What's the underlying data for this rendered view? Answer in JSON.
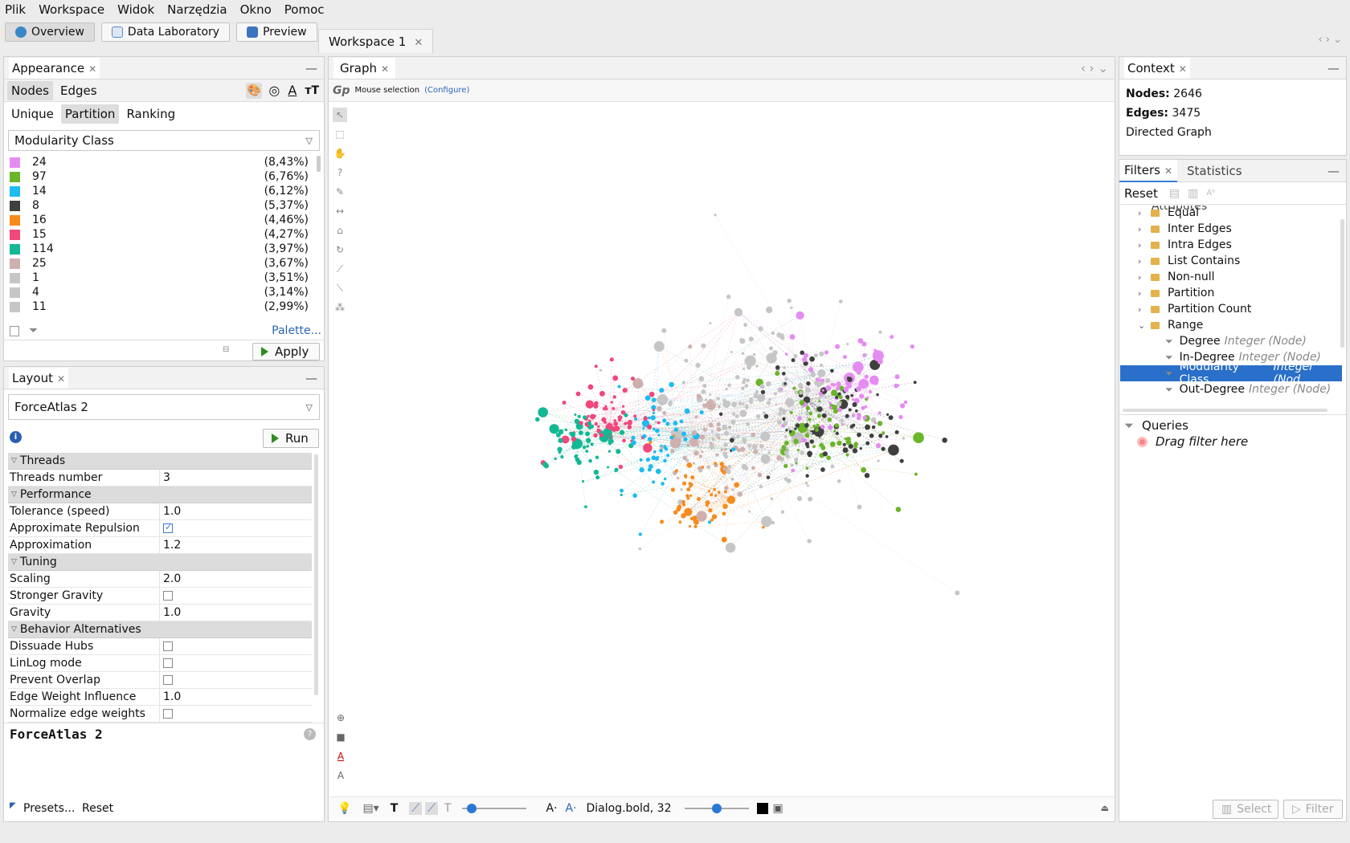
{
  "menu": [
    "Plik",
    "Workspace",
    "Widok",
    "Narzędzia",
    "Okno",
    "Pomoc"
  ],
  "modes": {
    "overview": "Overview",
    "data_lab": "Data Laboratory",
    "preview": "Preview"
  },
  "workspace_tab": "Workspace 1",
  "appearance": {
    "title": "Appearance",
    "tabs": {
      "nodes": "Nodes",
      "edges": "Edges"
    },
    "modes": {
      "unique": "Unique",
      "partition": "Partition",
      "ranking": "Ranking"
    },
    "attribute": "Modularity Class",
    "palette": "Palette...",
    "apply": "Apply",
    "partitions": [
      {
        "label": "24",
        "pct": "(8,43%)",
        "color": "#e58cf2"
      },
      {
        "label": "97",
        "pct": "(6,76%)",
        "color": "#6ab52a"
      },
      {
        "label": "14",
        "pct": "(6,12%)",
        "color": "#1ebbef"
      },
      {
        "label": "8",
        "pct": "(5,37%)",
        "color": "#3f3f3f"
      },
      {
        "label": "16",
        "pct": "(4,46%)",
        "color": "#f78b1c"
      },
      {
        "label": "15",
        "pct": "(4,27%)",
        "color": "#f0477c"
      },
      {
        "label": "114",
        "pct": "(3,97%)",
        "color": "#13b894"
      },
      {
        "label": "25",
        "pct": "(3,67%)",
        "color": "#cfb0ae"
      },
      {
        "label": "1",
        "pct": "(3,51%)",
        "color": "#c6c6c6"
      },
      {
        "label": "4",
        "pct": "(3,14%)",
        "color": "#c6c6c6"
      },
      {
        "label": "11",
        "pct": "(2,99%)",
        "color": "#c6c6c6"
      }
    ]
  },
  "layout": {
    "title": "Layout",
    "algorithm": "ForceAtlas 2",
    "run": "Run",
    "footer_title": "ForceAtlas 2",
    "presets": "Presets...",
    "reset": "Reset",
    "props": [
      {
        "group": "Threads"
      },
      {
        "k": "Threads number",
        "v": "3"
      },
      {
        "group": "Performance"
      },
      {
        "k": "Tolerance (speed)",
        "v": "1.0"
      },
      {
        "k": "Approximate Repulsion",
        "cb": true
      },
      {
        "k": "Approximation",
        "v": "1.2"
      },
      {
        "group": "Tuning"
      },
      {
        "k": "Scaling",
        "v": "2.0"
      },
      {
        "k": "Stronger Gravity",
        "cb": false
      },
      {
        "k": "Gravity",
        "v": "1.0"
      },
      {
        "group": "Behavior Alternatives"
      },
      {
        "k": "Dissuade Hubs",
        "cb": false
      },
      {
        "k": "LinLog mode",
        "cb": false
      },
      {
        "k": "Prevent Overlap",
        "cb": false
      },
      {
        "k": "Edge Weight Influence",
        "v": "1.0"
      },
      {
        "k": "Normalize edge weights",
        "cb": false
      }
    ]
  },
  "graph": {
    "title": "Graph",
    "mouse_selection": "Mouse selection",
    "configure": "(Configure)",
    "font_label": "Dialog.bold, 32"
  },
  "context": {
    "title": "Context",
    "nodes_label": "Nodes:",
    "nodes": "2646",
    "edges_label": "Edges:",
    "edges": "3475",
    "type": "Directed Graph"
  },
  "filters": {
    "tab_filters": "Filters",
    "tab_statistics": "Statistics",
    "reset": "Reset",
    "partial_item": "Attributes",
    "tree": [
      {
        "label": "Equal"
      },
      {
        "label": "Inter Edges"
      },
      {
        "label": "Intra Edges"
      },
      {
        "label": "List Contains"
      },
      {
        "label": "Non-null"
      },
      {
        "label": "Partition"
      },
      {
        "label": "Partition Count"
      },
      {
        "label": "Range",
        "open": true
      },
      {
        "leaf": "Degree",
        "type": "Integer (Node)"
      },
      {
        "leaf": "In-Degree",
        "type": "Integer (Node)"
      },
      {
        "leaf": "Modularity Class",
        "type": "Integer (Nod",
        "sel": true
      },
      {
        "leaf": "Out-Degree",
        "type": "Integer (Node)"
      }
    ],
    "queries": "Queries",
    "drag_here": "Drag filter here",
    "select": "Select",
    "filter": "Filter"
  }
}
